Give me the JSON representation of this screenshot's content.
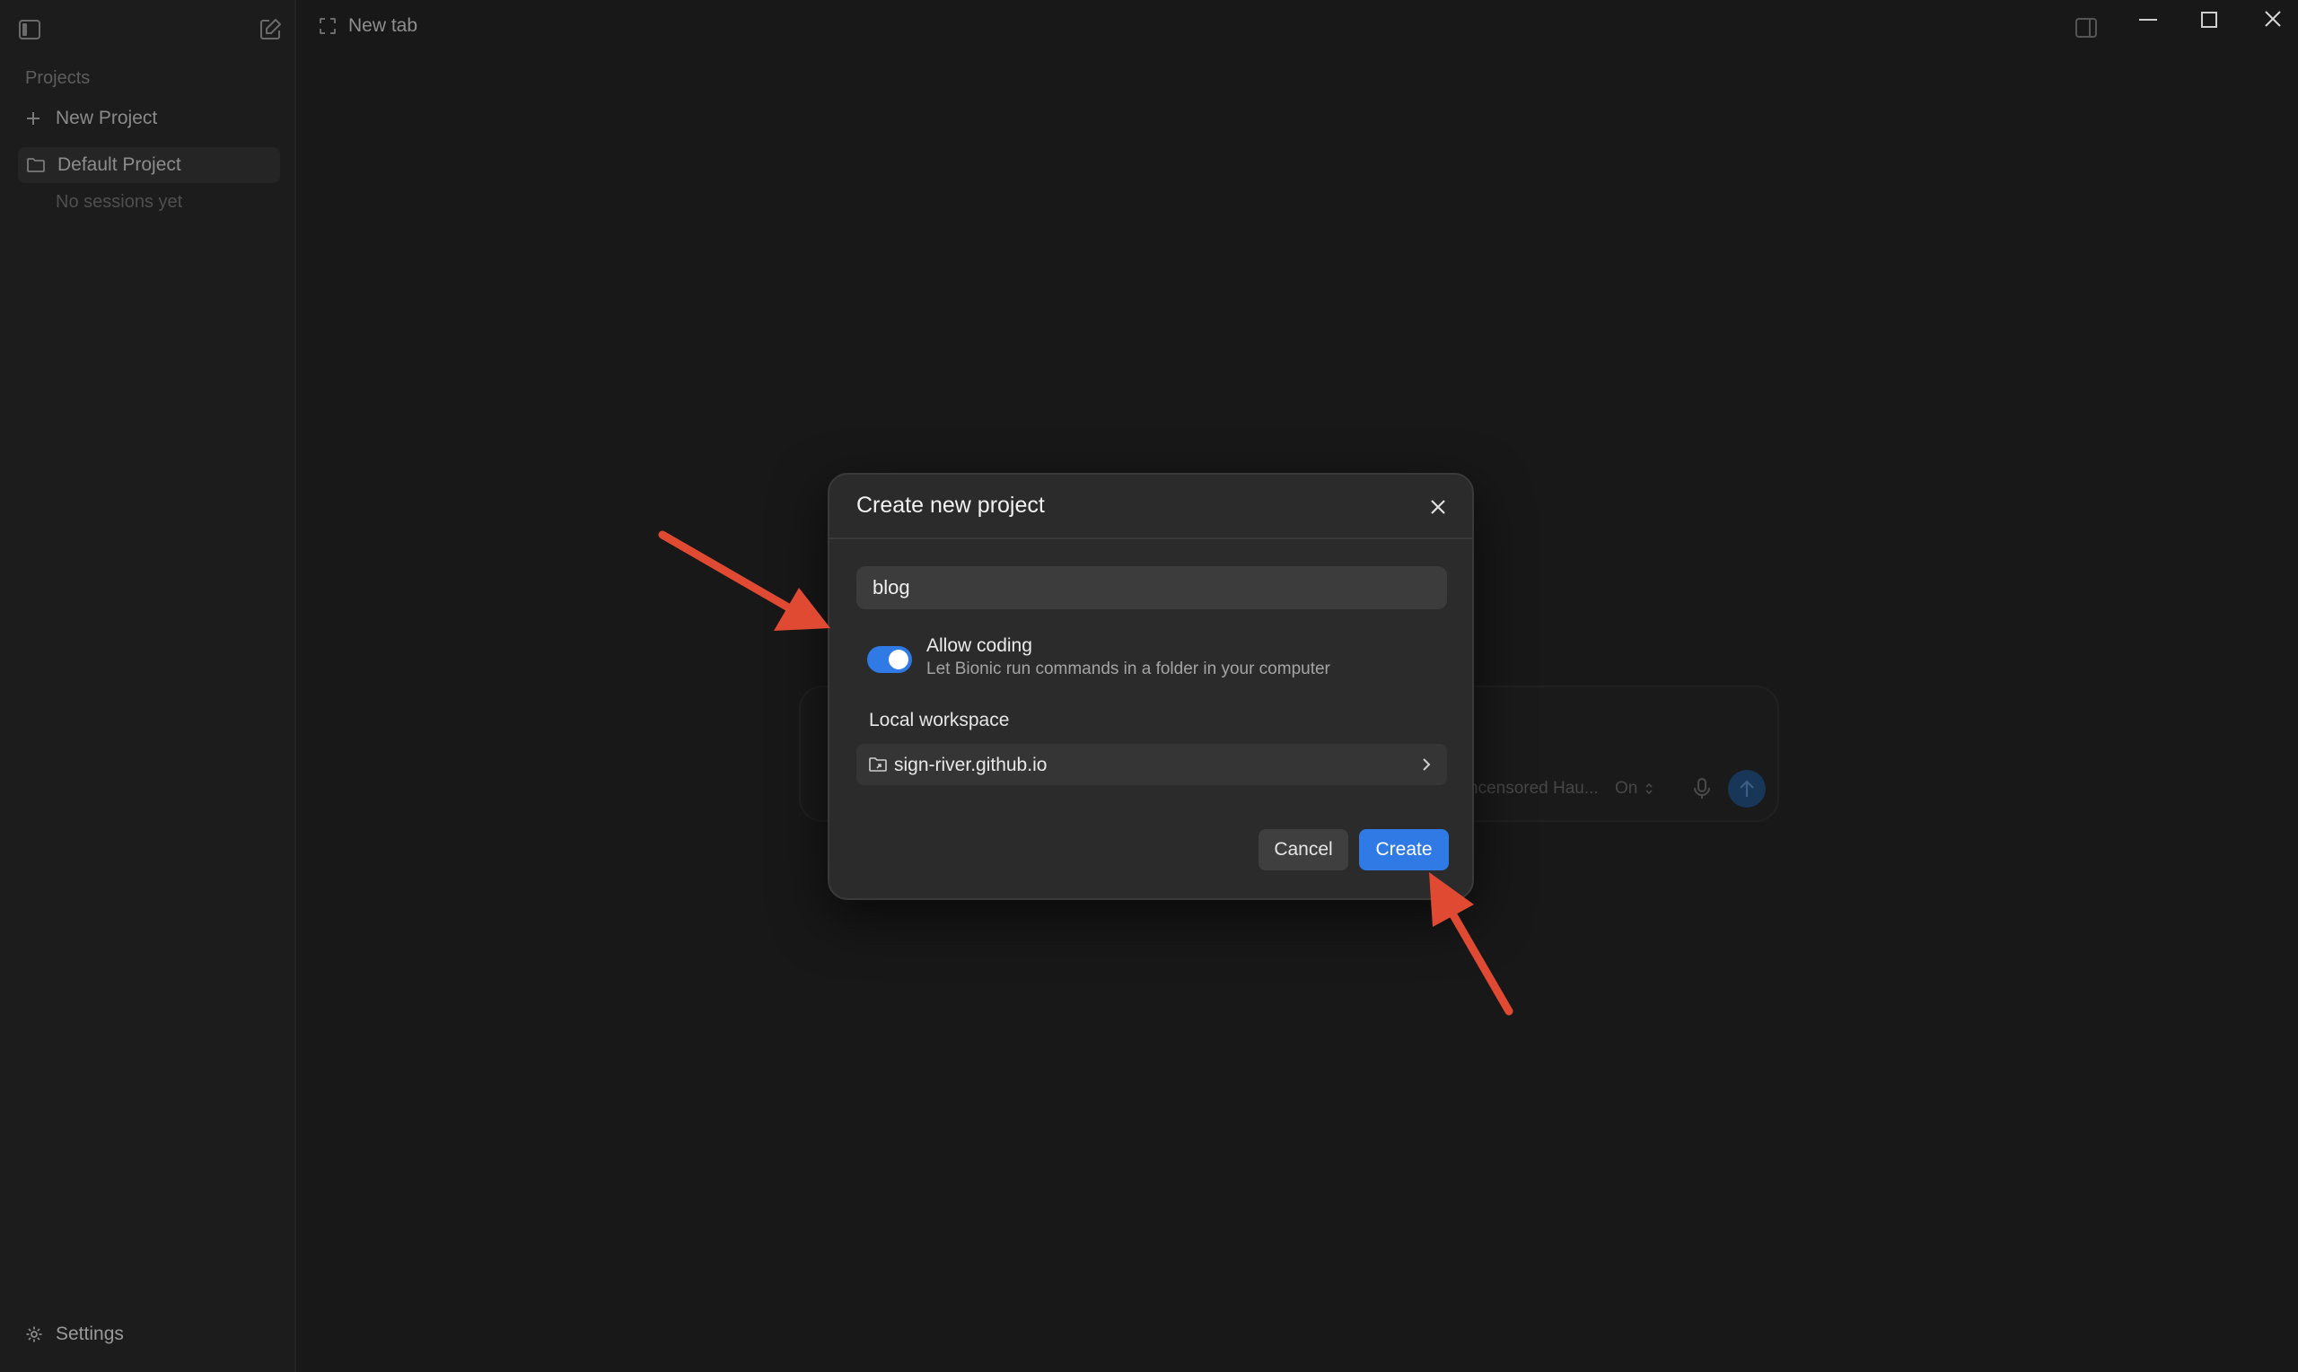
{
  "colors": {
    "background": "#181818",
    "sidebar": "#1c1c1c",
    "dialog": "#2b2b2b",
    "accent": "#2f7ae5",
    "annotation_arrow": "#e04a33"
  },
  "sidebar": {
    "toggle_icon": "sidebar-toggle-icon",
    "compose_icon": "edit-icon",
    "heading": "Projects",
    "new_project_label": "New Project",
    "projects": [
      {
        "label": "Default Project",
        "empty_text": "No sessions yet"
      }
    ],
    "settings_label": "Settings"
  },
  "topbar": {
    "tab_label": "New tab",
    "window_controls": [
      "panel-icon",
      "minimize-icon",
      "maximize-icon",
      "close-icon"
    ]
  },
  "composer": {
    "model_label": "ncensored Hau...",
    "toggle_value": "On"
  },
  "dialog": {
    "title": "Create new project",
    "name_value": "blog",
    "allow_coding": {
      "label": "Allow coding",
      "description": "Let Bionic run commands in a folder in your computer",
      "enabled": true
    },
    "workspace_label": "Local workspace",
    "workspace_path": "sign-river.github.io",
    "cancel_label": "Cancel",
    "create_label": "Create"
  }
}
